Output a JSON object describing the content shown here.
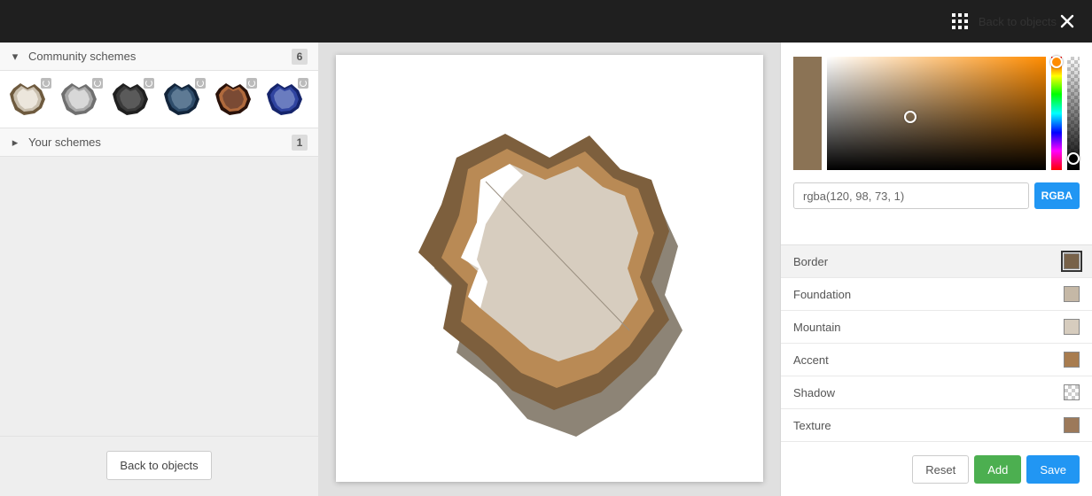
{
  "topbar": {
    "back_label": "Back to objects"
  },
  "left": {
    "community": {
      "title": "Community schemes",
      "count": "6"
    },
    "your": {
      "title": "Your schemes",
      "count": "1"
    },
    "footer_button": "Back to objects",
    "thumbs": [
      {
        "bg": "#ece6dc",
        "border": "#6e5a3e",
        "accent": "#c9bfae"
      },
      {
        "bg": "#d8d8d8",
        "border": "#6f6f6f",
        "accent": "#a9a9a9"
      },
      {
        "bg": "#5a5a5a",
        "border": "#1f1f1f",
        "accent": "#3a3a3a"
      },
      {
        "bg": "#5e7a94",
        "border": "#12243a",
        "accent": "#2f4d6b"
      },
      {
        "bg": "#7a4a34",
        "border": "#2a120a",
        "accent": "#b06a3d"
      },
      {
        "bg": "#6a7cbf",
        "border": "#15246b",
        "accent": "#3044a0"
      }
    ]
  },
  "picker": {
    "current_swatch": "#8b7355",
    "hue_base": "#ff8c00",
    "value": "rgba(120, 98, 73, 1)",
    "mode": "RGBA"
  },
  "layers": [
    {
      "name": "Border",
      "color": "#786249",
      "active": true
    },
    {
      "name": "Foundation",
      "color": "#c5b8a6",
      "active": false
    },
    {
      "name": "Mountain",
      "color": "#d6ccbe",
      "active": false
    },
    {
      "name": "Accent",
      "color": "#a87c4f",
      "active": false
    },
    {
      "name": "Shadow",
      "color": "checker",
      "active": false
    },
    {
      "name": "Texture",
      "color": "#9c795a",
      "active": false
    }
  ],
  "buttons": {
    "reset": "Reset",
    "add": "Add",
    "save": "Save"
  },
  "preview": {
    "shadow": "#8d8476",
    "foundation": "#bab0a0",
    "border": "#7d5f3d",
    "accent": "#b98a55",
    "mountain": "#d7cdbf",
    "highlight": "#ffffff"
  }
}
